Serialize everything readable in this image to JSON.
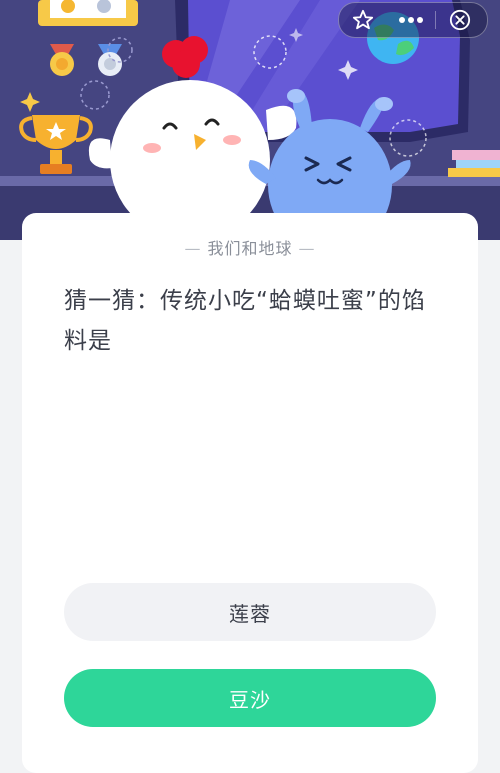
{
  "header": {
    "icons": [
      "star-icon",
      "more-dots-icon",
      "close-circle-icon"
    ],
    "colors": {
      "background": "#4a4a86",
      "window": "#5b4fd0",
      "mascot_body": "#ffffff",
      "monster_body": "#7fa9f5"
    }
  },
  "card": {
    "category": "我们和地球",
    "question": "猜一猜：传统小吃“蛤蟆吐蜜”的馅料是"
  },
  "options": [
    {
      "label": "莲蓉",
      "color": "#f1f2f5"
    },
    {
      "label": "豆沙",
      "color": "#2ed699"
    }
  ]
}
